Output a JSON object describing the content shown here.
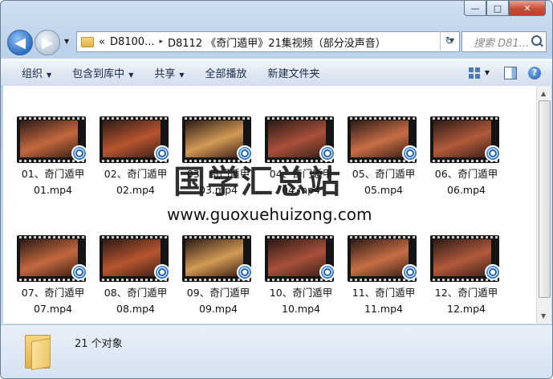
{
  "window": {
    "controls": {
      "minimize": "—",
      "maximize": "□",
      "close": "✕"
    }
  },
  "nav": {
    "back_icon": "back-arrow-icon",
    "forward_icon": "forward-arrow-icon",
    "history_glyph": "▼",
    "breadcrumb_overflow": "«",
    "breadcrumb": [
      "D8100...",
      "D8112 《奇门遁甲》21集视频（部分没声音）"
    ],
    "breadcrumb_separator": "▸",
    "refresh_glyph": "↻",
    "search_placeholder": "搜索 D81..."
  },
  "toolbar": {
    "items": [
      "组织",
      "包含到库中",
      "共享",
      "全部播放",
      "新建文件夹"
    ],
    "dropdown_arrow": "▼",
    "help": "?"
  },
  "files": [
    {
      "label": "01、奇门遁甲01.mp4",
      "line1": "01、奇门遁甲",
      "line2": "01.mp4"
    },
    {
      "label": "02、奇门遁甲02.mp4",
      "line1": "02、奇门遁甲",
      "line2": "02.mp4"
    },
    {
      "label": "03、奇门遁甲03.mp4",
      "line1": "03、奇门遁甲",
      "line2": "03.mp4"
    },
    {
      "label": "04、奇门遁甲04.mp4",
      "line1": "04、奇门遁甲",
      "line2": "04.mp4"
    },
    {
      "label": "05、奇门遁甲05.mp4",
      "line1": "05、奇门遁甲",
      "line2": "05.mp4"
    },
    {
      "label": "06、奇门遁甲06.mp4",
      "line1": "06、奇门遁甲",
      "line2": "06.mp4"
    },
    {
      "label": "07、奇门遁甲07.mp4",
      "line1": "07、奇门遁甲",
      "line2": "07.mp4"
    },
    {
      "label": "08、奇门遁甲08.mp4",
      "line1": "08、奇门遁甲",
      "line2": "08.mp4"
    },
    {
      "label": "09、奇门遁甲09.mp4",
      "line1": "09、奇门遁甲",
      "line2": "09.mp4"
    },
    {
      "label": "10、奇门遁甲10.mp4",
      "line1": "10、奇门遁甲",
      "line2": "10.mp4"
    },
    {
      "label": "11、奇门遁甲11.mp4",
      "line1": "11、奇门遁甲",
      "line2": "11.mp4"
    },
    {
      "label": "12、奇门遁甲12.mp4",
      "line1": "12、奇门遁甲",
      "line2": "12.mp4"
    }
  ],
  "watermark": {
    "title": "国学汇总站",
    "url": "www.guoxuehuizong.com"
  },
  "status": {
    "count": "21 个对象"
  },
  "colors": {
    "window_frame": "#bcd2ea",
    "toolbar": "#dfe8f3",
    "thumb_bg": "#141414",
    "thumb_frame": "#c4683e",
    "play_badge": "#1d5fb8",
    "close_button": "#c94b34"
  }
}
